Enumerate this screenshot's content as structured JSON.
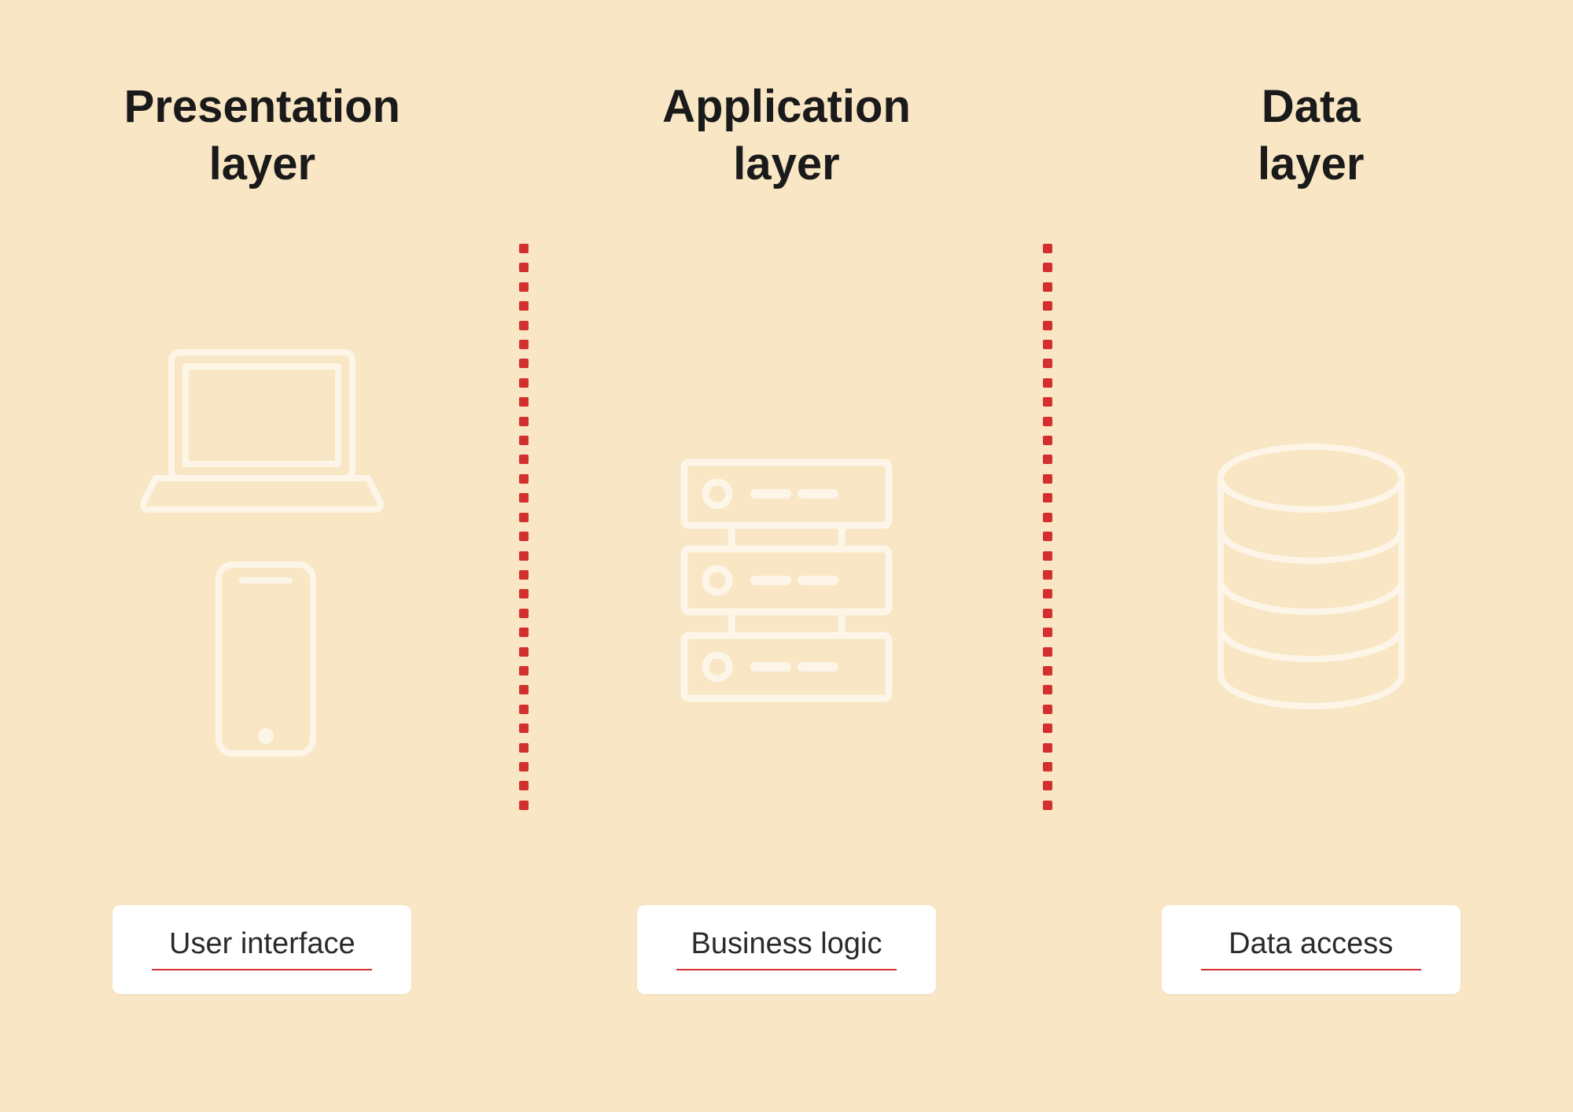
{
  "columns": [
    {
      "heading_line1": "Presentation",
      "heading_line2": "layer",
      "label": "User interface",
      "icon": "devices"
    },
    {
      "heading_line1": "Application",
      "heading_line2": "layer",
      "label": "Business logic",
      "icon": "server"
    },
    {
      "heading_line1": "Data",
      "heading_line2": "layer",
      "label": "Data access",
      "icon": "database"
    }
  ],
  "colors": {
    "background": "#f8e6c4",
    "icon_stroke": "#fdf6e8",
    "accent": "#d32f2f",
    "text": "#1a1a1a",
    "box_bg": "#ffffff"
  }
}
